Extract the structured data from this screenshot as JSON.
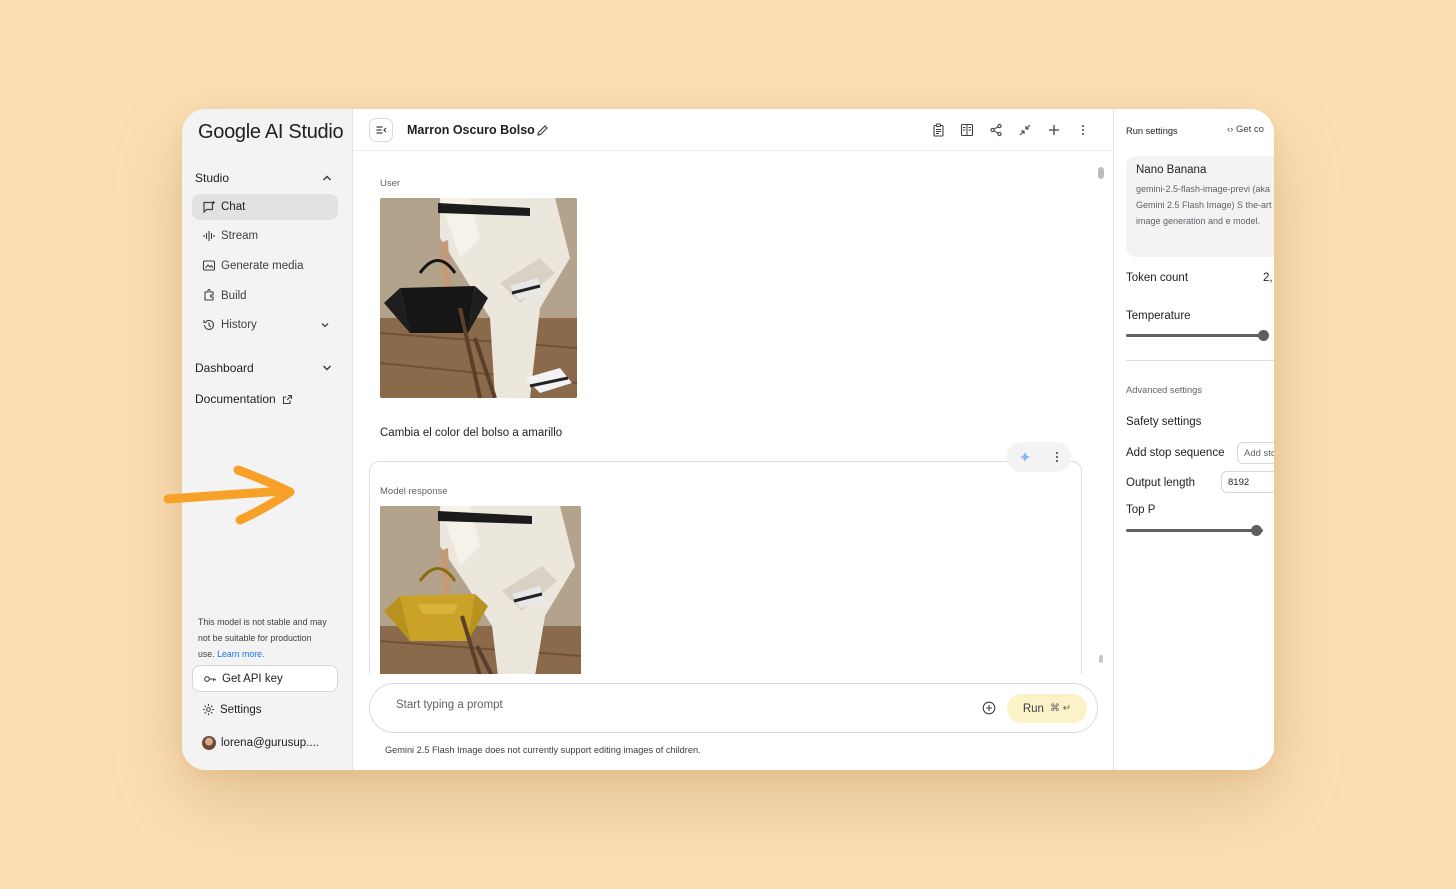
{
  "colors": {
    "background": "#fbdfb4",
    "accent_blue": "#1a73e8",
    "run_button": "#fbf2c7",
    "arrow": "#f7a128"
  },
  "sidebar": {
    "logo": "Google AI Studio",
    "studio_label": "Studio",
    "items": [
      {
        "label": "Chat",
        "icon": "chat-icon",
        "active": true
      },
      {
        "label": "Stream",
        "icon": "waveform-icon"
      },
      {
        "label": "Generate media",
        "icon": "media-icon"
      },
      {
        "label": "Build",
        "icon": "build-icon"
      },
      {
        "label": "History",
        "icon": "history-icon"
      }
    ],
    "dashboard_label": "Dashboard",
    "documentation_label": "Documentation",
    "warning_text": "This model is not stable and may not be suitable for production use.",
    "warning_link": "Learn more.",
    "api_key_label": "Get API key",
    "settings_label": "Settings",
    "user_email": "lorena@gurusup...."
  },
  "header": {
    "title": "Marron Oscuro Bolso",
    "icons": [
      "clipboard-icon",
      "compare-icon",
      "share-icon",
      "compress-icon",
      "add-icon",
      "more-icon"
    ]
  },
  "chat": {
    "user_label": "User",
    "user_message": "Cambia el color del bolso a amarillo",
    "model_label": "Model response",
    "user_image_desc": "black-bag-photo",
    "model_image_desc": "yellow-bag-photo"
  },
  "prompt": {
    "placeholder": "Start typing a prompt",
    "run_label": "Run",
    "run_shortcut": "⌘ ↵",
    "disclaimer": "Gemini 2.5 Flash Image does not currently support editing images of children."
  },
  "run_settings": {
    "header": "Run settings",
    "get_code": "Get co",
    "model_name": "Nano Banana",
    "model_desc": "gemini-2.5-flash-image-previ (aka Gemini 2.5 Flash Image) S the-art image generation and e model.",
    "token_count_label": "Token count",
    "token_count_value": "2,",
    "temperature_label": "Temperature",
    "temperature_value": 1.0,
    "advanced_label": "Advanced settings",
    "safety_label": "Safety settings",
    "stop_seq_label": "Add stop sequence",
    "stop_seq_placeholder": "Add sto",
    "output_length_label": "Output length",
    "output_length_value": "8192",
    "top_p_label": "Top P",
    "top_p_value": 0.95
  }
}
